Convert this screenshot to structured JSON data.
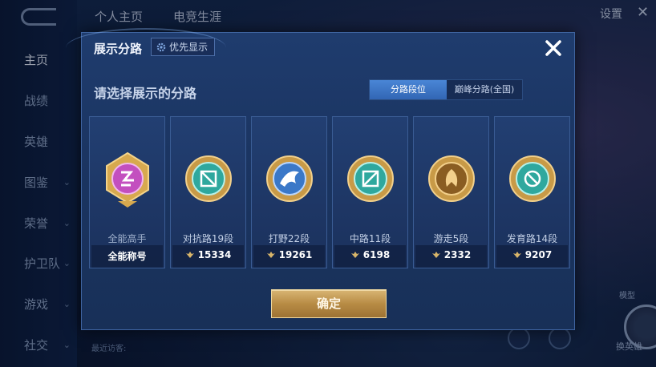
{
  "background": {
    "top_tabs": [
      "个人主页",
      "电竞生涯"
    ],
    "settings_label": "设置",
    "nav_items": [
      {
        "label": "主页",
        "active": true
      },
      {
        "label": "战绩",
        "active": false
      },
      {
        "label": "英雄",
        "active": false
      },
      {
        "label": "图鉴",
        "active": false
      },
      {
        "label": "荣誉",
        "active": false
      },
      {
        "label": "护卫队",
        "active": false
      },
      {
        "label": "游戏",
        "active": false
      },
      {
        "label": "社交",
        "active": false
      }
    ],
    "recent_visitors_label": "最近访客:",
    "model_label": "模型",
    "swap_label": "换英雄"
  },
  "modal": {
    "title": "展示分路",
    "priority_button": "优先显示",
    "subtitle": "请选择展示的分路",
    "segment": {
      "options": [
        "分路段位",
        "巅峰分路(全国)"
      ],
      "selected": "分路段位"
    },
    "cards": [
      {
        "name": "全能高手",
        "value": "全能称号",
        "emblem": "allround-icon",
        "color": "#c34fbf",
        "show_points_icon": false
      },
      {
        "name": "对抗路19段",
        "value": "15334",
        "emblem": "clash-lane-icon",
        "color": "#2fa89e",
        "show_points_icon": true
      },
      {
        "name": "打野22段",
        "value": "19261",
        "emblem": "jungle-icon",
        "color": "#3a78c8",
        "show_points_icon": true
      },
      {
        "name": "中路11段",
        "value": "6198",
        "emblem": "mid-lane-icon",
        "color": "#2fa89e",
        "show_points_icon": true
      },
      {
        "name": "游走5段",
        "value": "2332",
        "emblem": "roam-icon",
        "color": "#b8883c",
        "show_points_icon": true
      },
      {
        "name": "发育路14段",
        "value": "9207",
        "emblem": "farm-lane-icon",
        "color": "#2fa89e",
        "show_points_icon": true
      }
    ],
    "confirm_label": "确定"
  },
  "colors": {
    "accent_blue": "#3266b4",
    "gold": "#b88c45"
  }
}
